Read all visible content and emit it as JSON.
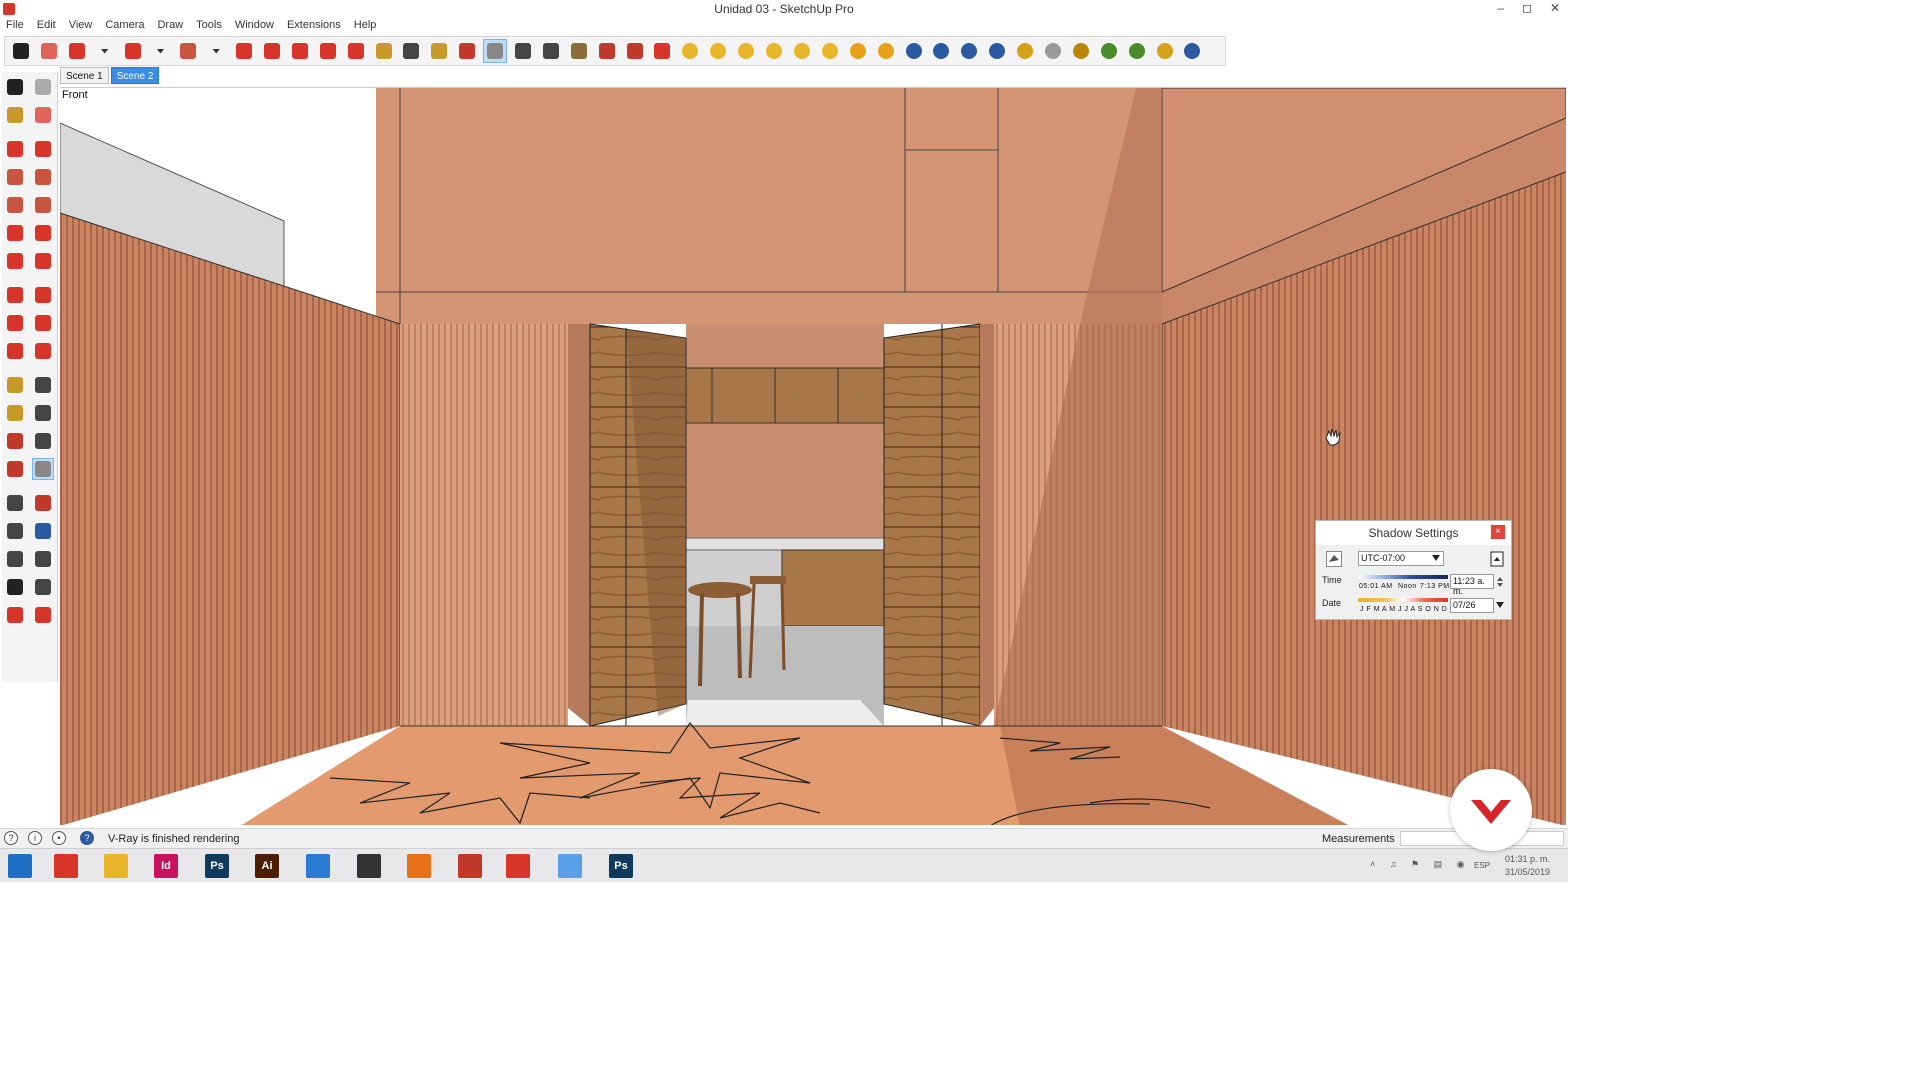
{
  "window": {
    "title": "Unidad 03 - SketchUp Pro",
    "controls": [
      "–",
      "◻",
      "✕"
    ]
  },
  "menu": [
    "File",
    "Edit",
    "View",
    "Camera",
    "Draw",
    "Tools",
    "Window",
    "Extensions",
    "Help"
  ],
  "toolbar_icons": [
    {
      "name": "select-icon",
      "color": "#222222"
    },
    {
      "name": "eraser-icon",
      "color": "#e0645a"
    },
    {
      "name": "pencil-icon",
      "color": "#d8352a"
    },
    {
      "name": "dropdown-icon",
      "color": "#333333"
    },
    {
      "name": "arc-icon",
      "color": "#d8352a"
    },
    {
      "name": "dropdown-icon",
      "color": "#333333"
    },
    {
      "name": "rectangle-icon",
      "color": "#c8553f"
    },
    {
      "name": "dropdown-icon",
      "color": "#333333"
    },
    {
      "name": "push-pull-icon",
      "color": "#d8352a"
    },
    {
      "name": "follow-me-icon",
      "color": "#d8352a"
    },
    {
      "name": "move-icon",
      "color": "#d8352a"
    },
    {
      "name": "rotate-icon",
      "color": "#d8352a"
    },
    {
      "name": "scale-icon",
      "color": "#d8352a"
    },
    {
      "name": "tape-measure-icon",
      "color": "#c79a2a"
    },
    {
      "name": "text-icon",
      "color": "#444444"
    },
    {
      "name": "paint-bucket-icon",
      "color": "#c79a2a"
    },
    {
      "name": "orbit-icon",
      "color": "#c0392b"
    },
    {
      "name": "pan-icon",
      "color": "#888888"
    },
    {
      "name": "zoom-icon",
      "color": "#444444"
    },
    {
      "name": "zoom-extents-icon",
      "color": "#444444"
    },
    {
      "name": "warehouse-icon",
      "color": "#8a6d3b"
    },
    {
      "name": "extension-warehouse-icon",
      "color": "#c0392b"
    },
    {
      "name": "share-model-icon",
      "color": "#c0392b"
    },
    {
      "name": "layout-icon",
      "color": "#d8352a"
    },
    {
      "name": "vray-sphere-icon",
      "color": "#e8b52a"
    },
    {
      "name": "vray-light-icon",
      "color": "#e8b52a"
    },
    {
      "name": "vray-spot-icon",
      "color": "#e8b52a"
    },
    {
      "name": "vray-dome-icon",
      "color": "#e8b52a"
    },
    {
      "name": "vray-omni-icon",
      "color": "#e8b52a"
    },
    {
      "name": "vray-ies-icon",
      "color": "#e8b52a"
    },
    {
      "name": "vray-material-editor-icon",
      "color": "#e8a21a"
    },
    {
      "name": "vray-options-icon",
      "color": "#e8a21a"
    },
    {
      "name": "vray-render-icon",
      "color": "#2c5aa0"
    },
    {
      "name": "vray-rt-icon",
      "color": "#2c5aa0"
    },
    {
      "name": "vray-batch-icon",
      "color": "#2c5aa0"
    },
    {
      "name": "vray-help-icon",
      "color": "#2c5aa0"
    },
    {
      "name": "vray-tag-icon",
      "color": "#d4a017"
    },
    {
      "name": "vray-sphere-proxy-icon",
      "color": "#999999"
    },
    {
      "name": "vray-plane-icon",
      "color": "#b8860b"
    },
    {
      "name": "vray-proxy-icon",
      "color": "#4a8a2a"
    },
    {
      "name": "vray-proxy-export-icon",
      "color": "#4a8a2a"
    },
    {
      "name": "vray-fur-icon",
      "color": "#d4a017"
    },
    {
      "name": "vray-pause-icon",
      "color": "#2c5aa0"
    }
  ],
  "left_tools": [
    {
      "name": "select-icon",
      "color": "#222222"
    },
    {
      "name": "make-component-icon",
      "color": "#aaaaaa"
    },
    {
      "name": "paint-bucket-icon",
      "color": "#c79a2a"
    },
    {
      "name": "eraser-icon",
      "color": "#e0645a"
    },
    {
      "name": "line-icon",
      "color": "#d8352a"
    },
    {
      "name": "freehand-icon",
      "color": "#d8352a"
    },
    {
      "name": "rectangle-icon",
      "color": "#c8553f"
    },
    {
      "name": "rotated-rectangle-icon",
      "color": "#c8553f"
    },
    {
      "name": "circle-icon",
      "color": "#c8553f"
    },
    {
      "name": "polygon-icon",
      "color": "#c8553f"
    },
    {
      "name": "arc-icon",
      "color": "#d8352a"
    },
    {
      "name": "two-point-arc-icon",
      "color": "#d8352a"
    },
    {
      "name": "three-point-arc-icon",
      "color": "#d8352a"
    },
    {
      "name": "pie-icon",
      "color": "#d8352a"
    },
    {
      "name": "move-icon",
      "color": "#d8352a"
    },
    {
      "name": "push-pull-icon",
      "color": "#d8352a"
    },
    {
      "name": "rotate-icon",
      "color": "#d8352a"
    },
    {
      "name": "follow-me-icon",
      "color": "#d8352a"
    },
    {
      "name": "scale-icon",
      "color": "#d8352a"
    },
    {
      "name": "offset-icon",
      "color": "#d8352a"
    },
    {
      "name": "tape-measure-icon",
      "color": "#c79a2a"
    },
    {
      "name": "dimension-icon",
      "color": "#444444"
    },
    {
      "name": "protractor-icon",
      "color": "#c79a2a"
    },
    {
      "name": "text-icon",
      "color": "#444444"
    },
    {
      "name": "axes-icon",
      "color": "#c0392b"
    },
    {
      "name": "3d-text-icon",
      "color": "#444444"
    },
    {
      "name": "orbit-icon",
      "color": "#c0392b"
    },
    {
      "name": "pan-icon",
      "color": "#888888"
    },
    {
      "name": "zoom-icon",
      "color": "#444444"
    },
    {
      "name": "zoom-window-icon",
      "color": "#c0392b"
    },
    {
      "name": "zoom-extents-icon",
      "color": "#444444"
    },
    {
      "name": "previous-view-icon",
      "color": "#2c5aa0"
    },
    {
      "name": "position-camera-icon",
      "color": "#444444"
    },
    {
      "name": "look-around-icon",
      "color": "#444444"
    },
    {
      "name": "walk-icon",
      "color": "#222222"
    },
    {
      "name": "section-plane-icon",
      "color": "#444444"
    },
    {
      "name": "sandbox-icon",
      "color": "#d8352a"
    },
    {
      "name": "grid-icon",
      "color": "#d8352a"
    }
  ],
  "scenes": [
    {
      "label": "Scene 1",
      "selected": false
    },
    {
      "label": "Scene 2",
      "selected": true
    }
  ],
  "viewport": {
    "label": "Front"
  },
  "shadow_settings": {
    "title": "Shadow Settings",
    "close_label": "×",
    "timezone": "UTC-07:00",
    "time_label": "Time",
    "time_marks": [
      "05:01 AM",
      "Noon",
      "7:13 PM"
    ],
    "time_value": "11:23 a. m.",
    "date_label": "Date",
    "month_letters": "J F M A M J J A S O N D",
    "date_value": "07/26"
  },
  "status": {
    "icons": [
      "geo-location-icon",
      "credits-icon",
      "user-icon",
      "help-icon"
    ],
    "message": "V-Ray is finished rendering",
    "measurements_label": "Measurements",
    "measurements_value": ""
  },
  "taskbar": {
    "apps": [
      {
        "name": "windows-start-icon",
        "label": "",
        "color": "#1f6fc4"
      },
      {
        "name": "sketchup-taskbar-icon",
        "label": "",
        "color": "#d8352a"
      },
      {
        "name": "file-explorer-icon",
        "label": "",
        "color": "#e8b52a"
      },
      {
        "name": "indesign-icon",
        "label": "Id",
        "color": "#c7135d"
      },
      {
        "name": "photoshop-icon",
        "label": "Ps",
        "color": "#0f3a5c"
      },
      {
        "name": "illustrator-icon",
        "label": "Ai",
        "color": "#4a1f06"
      },
      {
        "name": "layout-taskbar-icon",
        "label": "",
        "color": "#2c7bd4"
      },
      {
        "name": "stack-icon",
        "label": "",
        "color": "#333333"
      },
      {
        "name": "firefox-icon",
        "label": "",
        "color": "#e8711a"
      },
      {
        "name": "snipping-tool-icon",
        "label": "",
        "color": "#c0392b"
      },
      {
        "name": "sketchup-active-icon",
        "label": "",
        "color": "#d8352a"
      },
      {
        "name": "cortana-icon",
        "label": "",
        "color": "#5aa0e8"
      },
      {
        "name": "photoshop-active-icon",
        "label": "Ps",
        "color": "#0f3a5c"
      }
    ],
    "lang": "ESP",
    "time": "01:31 p. m.",
    "date": "31/05/2019"
  },
  "colors": {
    "accent": "#3a8ee6",
    "wall": "#d49070",
    "wood": "#9b6c40",
    "floor": "#e39a6e"
  }
}
